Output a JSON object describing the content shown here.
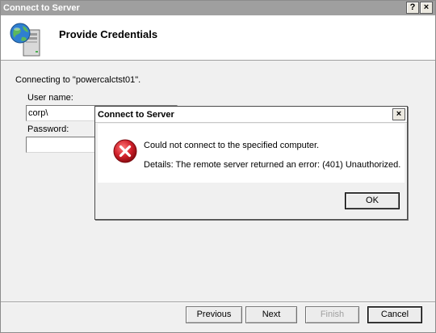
{
  "main_window": {
    "title": "Connect to Server",
    "help_glyph": "?",
    "close_glyph": "×",
    "header_title": "Provide Credentials",
    "header_icon": "globe-server-icon",
    "connecting_text": "Connecting to \"powercalctst01\".",
    "username_label": "User name:",
    "username_value": "corp\\",
    "password_label": "Password:",
    "password_value": "",
    "buttons": {
      "previous": "Previous",
      "next": "Next",
      "finish": "Finish",
      "cancel": "Cancel"
    }
  },
  "error_dialog": {
    "title": "Connect to Server",
    "close_glyph": "×",
    "icon": "error-icon",
    "message": "Could not connect to the specified computer.",
    "details": "Details: The remote server returned an error: (401) Unauthorized.",
    "ok_label": "OK"
  },
  "colors": {
    "inactive_titlebar": "#9f9f9f",
    "error_red": "#d0202a",
    "dialog_bg": "#f0f0f0"
  }
}
